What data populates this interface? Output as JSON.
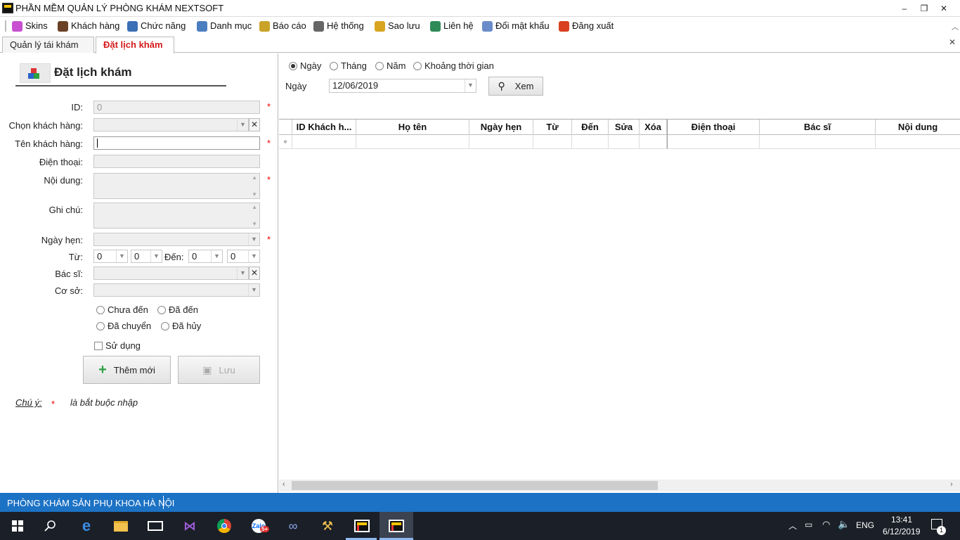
{
  "window": {
    "title": "PHẦN MỀM QUẢN LÝ PHÒNG KHÁM NEXTSOFT",
    "minimize": "–",
    "restore": "❐",
    "close": "✕"
  },
  "menu": [
    {
      "label": "Skins",
      "icon": "skins-palette-icon",
      "color": "#c84fd0"
    },
    {
      "label": "Khách hàng",
      "icon": "customer-person-icon",
      "color": "#6b4226"
    },
    {
      "label": "Chức năng",
      "icon": "functions-icon",
      "color": "#3b6fb6"
    },
    {
      "label": "Danh mục",
      "icon": "catalog-icon",
      "color": "#4a7ebf"
    },
    {
      "label": "Báo cáo",
      "icon": "report-icon",
      "color": "#c9a227"
    },
    {
      "label": "Hệ thống",
      "icon": "system-gear-icon",
      "color": "#666"
    },
    {
      "label": "Sao lưu",
      "icon": "backup-database-icon",
      "color": "#d9a521"
    },
    {
      "label": "Liên hệ",
      "icon": "contact-person-icon",
      "color": "#2e8b57"
    },
    {
      "label": "Đổi mật khẩu",
      "icon": "password-key-icon",
      "color": "#6a8cc9"
    },
    {
      "label": "Đăng xuất",
      "icon": "logout-icon",
      "color": "#d9401f"
    }
  ],
  "tabs": [
    {
      "label": "Quản lý tái khám"
    },
    {
      "label": "Đặt lịch khám"
    }
  ],
  "tab_close": "✕",
  "form": {
    "title": "Đặt lịch khám",
    "id_label": "ID:",
    "id_value": "0",
    "customer_select_label": "Chọn khách hàng:",
    "customer_name_label": "Tên khách hàng:",
    "phone_label": "Điện thoại:",
    "content_label": "Nội dung:",
    "note_label": "Ghi chú:",
    "appointment_date_label": "Ngày hẹn:",
    "from_label": "Từ:",
    "to_label": "Đến:",
    "from_hour": "0",
    "from_minute": "0",
    "to_hour": "0",
    "to_minute": "0",
    "doctor_label": "Bác sĩ:",
    "facility_label": "Cơ sở:",
    "status_not_arrived": "Chưa đến",
    "status_arrived": "Đã đến",
    "status_transferred": "Đã chuyển",
    "status_cancelled": "Đã hủy",
    "in_use_label": "Sử dụng",
    "add_button": "Thêm mới",
    "save_button": "Lưu",
    "required_mark": "*",
    "note_prefix": "Chú ý:",
    "note_text": "là bắt buộc nhập"
  },
  "filter": {
    "period_day": "Ngày",
    "period_month": "Tháng",
    "period_year": "Năm",
    "period_range": "Khoảng thời gian",
    "selected_period": "Ngày",
    "date_label": "Ngày",
    "date_value": "12/06/2019",
    "view_button": "Xem"
  },
  "grid": {
    "columns": [
      "ID Khách h...",
      "Họ tên",
      "Ngày hẹn",
      "Từ",
      "Đến",
      "Sửa",
      "Xóa",
      "Điện thoại",
      "Bác sĩ",
      "Nội dung"
    ],
    "filter_row_icon": "ᵠ"
  },
  "statusbar": {
    "clinic": "PHÒNG KHÁM SẢN PHỤ KHOA HÀ NỘI"
  },
  "taskbar": {
    "language": "ENG",
    "time": "13:41",
    "date": "6/12/2019",
    "notifications": "1",
    "zalo_badge": "5+"
  }
}
